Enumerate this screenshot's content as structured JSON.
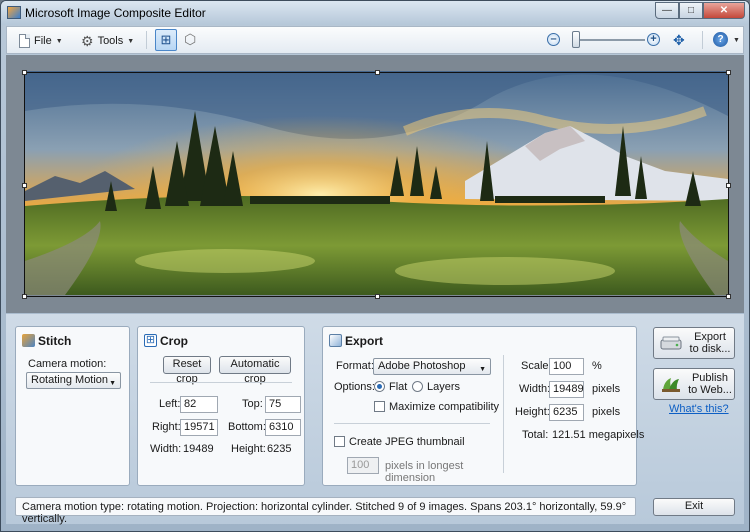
{
  "window": {
    "title": "Microsoft Image Composite Editor"
  },
  "toolbar": {
    "file_label": "File",
    "tools_label": "Tools"
  },
  "stitch": {
    "title": "Stitch",
    "camera_motion_label": "Camera motion:",
    "camera_motion_value": "Rotating Motion"
  },
  "crop": {
    "title": "Crop",
    "reset_label": "Reset crop",
    "auto_label": "Automatic crop",
    "left_label": "Left:",
    "left_value": "82",
    "top_label": "Top:",
    "top_value": "75",
    "right_label": "Right:",
    "right_value": "19571",
    "bottom_label": "Bottom:",
    "bottom_value": "6310",
    "width_label": "Width:",
    "width_value": "19489",
    "height_label": "Height:",
    "height_value": "6235"
  },
  "export": {
    "title": "Export",
    "format_label": "Format:",
    "format_value": "Adobe Photoshop",
    "options_label": "Options:",
    "flat_label": "Flat",
    "layers_label": "Layers",
    "maximize_label": "Maximize compatibility",
    "jpeg_label": "Create JPEG thumbnail",
    "thumb_value": "100",
    "thumb_unit_line1": "pixels in longest",
    "thumb_unit_line2": "dimension",
    "scale_label": "Scale:",
    "scale_value": "100",
    "scale_unit": "%",
    "width_label": "Width:",
    "width_value": "19489",
    "width_unit": "pixels",
    "height_label": "Height:",
    "height_value": "6235",
    "height_unit": "pixels",
    "total_label": "Total:",
    "total_value": "121.51 megapixels"
  },
  "actions": {
    "export_disk_line1": "Export",
    "export_disk_line2": "to disk...",
    "publish_line1": "Publish",
    "publish_line2": "to Web...",
    "whats_this": "What's this?",
    "exit": "Exit"
  },
  "status": "Camera motion type: rotating motion. Projection: horizontal cylinder. Stitched 9 of 9 images. Spans 203.1° horizontally, 59.9° vertically.",
  "colors": {
    "accent": "#2a6bb5",
    "sky_glow": "#f5a623",
    "meadow": "#6f8f2e"
  }
}
